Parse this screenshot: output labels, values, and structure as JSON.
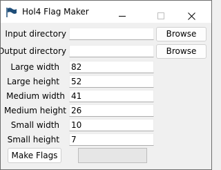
{
  "window": {
    "title": "Hol4 Flag Maker"
  },
  "icons": {
    "app": "flag-icon",
    "minimize": "minimize-icon",
    "maximize": "maximize-icon",
    "close": "close-icon"
  },
  "form": {
    "input_directory_label": "Input directory",
    "input_directory_value": "",
    "output_directory_label": "Output directory",
    "output_directory_value": "",
    "browse_input_label": "Browse",
    "browse_output_label": "Browse",
    "large_width_label": "Large width",
    "large_width_value": "82",
    "large_height_label": "Large height",
    "large_height_value": "52",
    "medium_width_label": "Medium width",
    "medium_width_value": "41",
    "medium_height_label": "Medium height",
    "medium_height_value": "26",
    "small_width_label": "Small width",
    "small_width_value": "10",
    "small_height_label": "Small height",
    "small_height_value": "7",
    "make_flags_label": "Make Flags"
  },
  "progress": {
    "fraction": 0
  },
  "colors": {
    "progress_fill": "#06b025",
    "flag_icon": "#1f4e79"
  }
}
